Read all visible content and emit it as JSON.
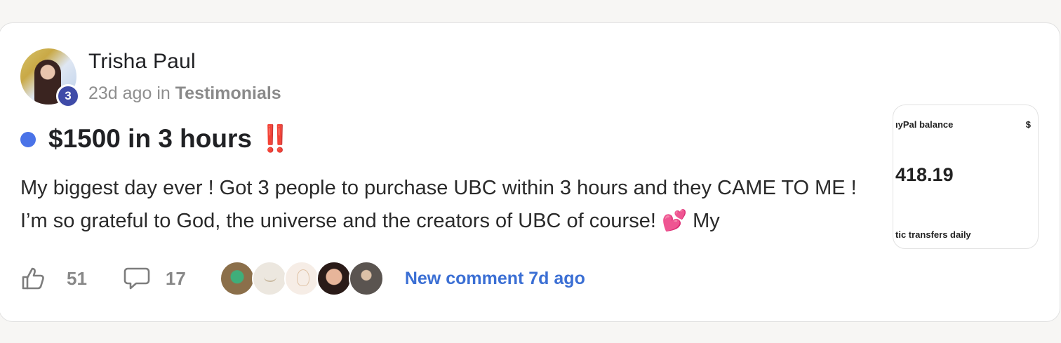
{
  "post": {
    "author": {
      "name": "Trisha Paul",
      "level": "3"
    },
    "time": "23d ago",
    "in_label": "in",
    "category": "Testimonials",
    "title": "$1500 in 3 hours ‼️",
    "excerpt": "My biggest day ever ! Got 3 people to purchase UBC within 3 hours and they CAME TO ME ! I’m so grateful to God, the universe and the creators of UBC of course! 💕 My",
    "thumbnail": {
      "line1": "ıyPal balance",
      "currency": "$",
      "amount": "418.19",
      "line3": "tic transfers daily"
    },
    "likes": "51",
    "comments": "17",
    "last_comment": "New comment 7d ago",
    "unread_dot_color": "#4a73e8",
    "link_color": "#3b6fd4"
  }
}
